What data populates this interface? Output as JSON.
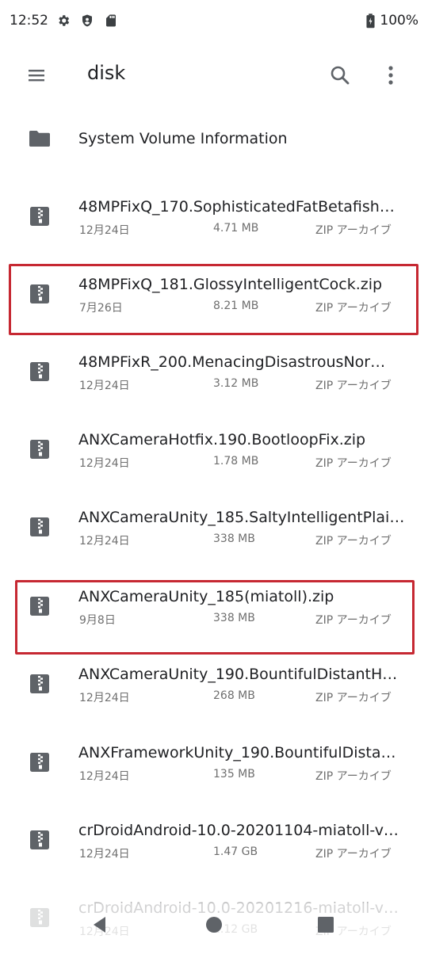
{
  "status_bar": {
    "time": "12:52",
    "icons": [
      "gear-icon",
      "shield-icon",
      "sd-card-icon"
    ],
    "battery": "100%"
  },
  "app_bar": {
    "title": "disk",
    "menu_icon": "hamburger-menu-icon",
    "search_icon": "search-icon",
    "more_icon": "more-vert-icon"
  },
  "files": [
    {
      "name": "System Volume Information",
      "kind": "folder"
    },
    {
      "name": "48MPFixQ_170.SophisticatedFatBetafish…",
      "date": "12月24日",
      "size": "4.71 MB",
      "type": "ZIP アーカイブ",
      "kind": "zip"
    },
    {
      "name": "48MPFixQ_181.GlossyIntelligentCock.zip",
      "date": "7月26日",
      "size": "8.21 MB",
      "type": "ZIP アーカイブ",
      "kind": "zip",
      "highlighted": true
    },
    {
      "name": "48MPFixR_200.MenacingDisastrousNor…",
      "date": "12月24日",
      "size": "3.12 MB",
      "type": "ZIP アーカイブ",
      "kind": "zip"
    },
    {
      "name": "ANXCameraHotfix.190.BootloopFix.zip",
      "date": "12月24日",
      "size": "1.78 MB",
      "type": "ZIP アーカイブ",
      "kind": "zip"
    },
    {
      "name": "ANXCameraUnity_185.SaltyIntelligentPlai…",
      "date": "12月24日",
      "size": "338 MB",
      "type": "ZIP アーカイブ",
      "kind": "zip"
    },
    {
      "name": "ANXCameraUnity_185(miatoll).zip",
      "date": "9月8日",
      "size": "338 MB",
      "type": "ZIP アーカイブ",
      "kind": "zip",
      "highlighted": true
    },
    {
      "name": "ANXCameraUnity_190.BountifulDistantH…",
      "date": "12月24日",
      "size": "268 MB",
      "type": "ZIP アーカイブ",
      "kind": "zip"
    },
    {
      "name": "ANXFrameworkUnity_190.BountifulDista…",
      "date": "12月24日",
      "size": "135 MB",
      "type": "ZIP アーカイブ",
      "kind": "zip"
    },
    {
      "name": "crDroidAndroid-10.0-20201104-miatoll-v…",
      "date": "12月24日",
      "size": "1.47 GB",
      "type": "ZIP アーカイブ",
      "kind": "zip"
    },
    {
      "name": "crDroidAndroid-10.0-20201216-miatoll-v…",
      "date": "12月24日",
      "size": "1.12 GB",
      "type": "ZIP アーカイブ",
      "kind": "zip"
    }
  ],
  "nav_bar": {
    "back_icon": "back-triangle-icon",
    "home_icon": "home-circle-icon",
    "recents_icon": "recents-square-icon"
  },
  "colors": {
    "highlight": "#c62832",
    "icon_gray": "#5f6368",
    "meta_text": "#6f6f6f"
  }
}
